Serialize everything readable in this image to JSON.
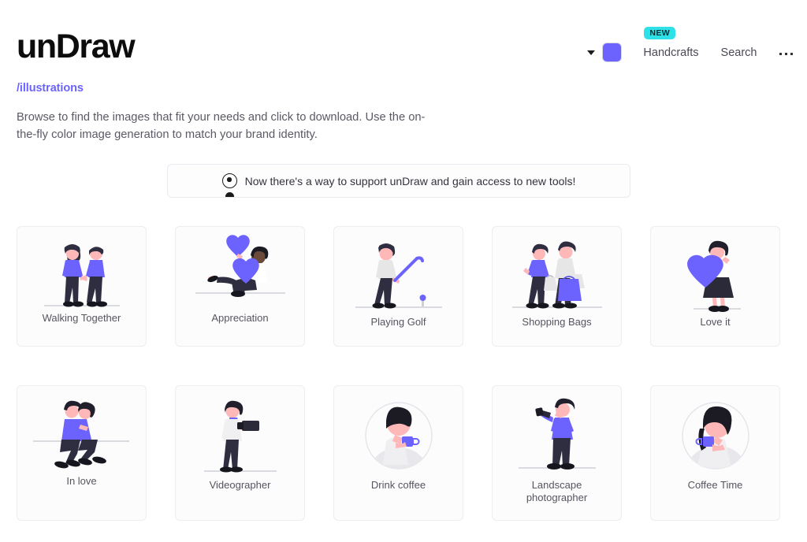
{
  "header": {
    "logo": "unDraw",
    "color_swatch_value": "#6c63ff",
    "caret_icon": "chevron-down-icon",
    "badge_new": "NEW",
    "links": [
      {
        "label": "Handcrafts"
      },
      {
        "label": "Search"
      }
    ],
    "more_icon": "ellipsis-horizontal-icon"
  },
  "breadcrumb": "/illustrations",
  "intro": "Browse to find the images that fit your needs and click to download. Use the on-the-fly color image generation to match your brand identity.",
  "promo": {
    "icon": "account-circle-icon",
    "text": "Now there's a way to support unDraw and gain access to new tools!"
  },
  "accent_color": "#6c63ff",
  "badge_color": "#2ee1e8",
  "grid": {
    "cards": [
      {
        "label": "Walking Together",
        "art": "walking-together"
      },
      {
        "label": "Appreciation",
        "art": "appreciation"
      },
      {
        "label": "Playing Golf",
        "art": "playing-golf"
      },
      {
        "label": "Shopping Bags",
        "art": "shopping-bags"
      },
      {
        "label": "Love it",
        "art": "love-it"
      },
      {
        "label": "In love",
        "art": "in-love"
      },
      {
        "label": "Videographer",
        "art": "videographer"
      },
      {
        "label": "Drink coffee",
        "art": "drink-coffee"
      },
      {
        "label": "Landscape photographer",
        "art": "landscape-photographer"
      },
      {
        "label": "Coffee Time",
        "art": "coffee-time"
      }
    ]
  }
}
